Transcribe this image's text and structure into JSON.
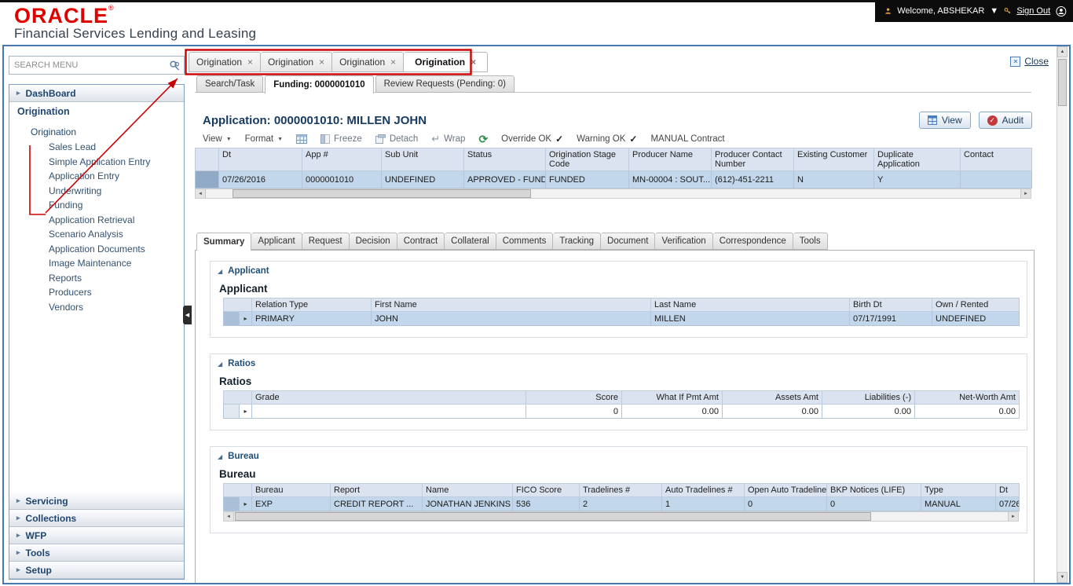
{
  "icons": {
    "caret_down": "▼",
    "chevron_right": "▸",
    "row_expand": "▸",
    "close_box_x": "✕",
    "tab_close": "×",
    "check": "✓",
    "scroll_up": "▲",
    "scroll_down": "▼",
    "scroll_left": "◄",
    "scroll_right": "►",
    "section_disclosure": "◢",
    "collapse_handle": "◀",
    "wrap_arrow": "↵",
    "refresh": "⟳"
  },
  "header": {
    "logo": "ORACLE",
    "logo_mark": "®",
    "subtitle": "Financial Services Lending and Leasing",
    "welcome_label": "Welcome, ABSHEKAR",
    "sign_out_label": "Sign Out"
  },
  "sidebar": {
    "search_placeholder": "SEARCH MENU",
    "dashboard_label": "DashBoard",
    "origination_section_label": "Origination",
    "tree_root": "Origination",
    "tree_items": [
      "Sales Lead",
      "Simple Application Entry",
      "Application Entry",
      "Underwriting",
      "Funding",
      "Application Retrieval",
      "Scenario Analysis",
      "Application Documents",
      "Image Maintenance",
      "Reports",
      "Producers",
      "Vendors"
    ],
    "bottom_items": [
      "Servicing",
      "Collections",
      "WFP",
      "Tools",
      "Setup"
    ]
  },
  "window_tabs": [
    "Origination",
    "Origination",
    "Origination",
    "Origination"
  ],
  "close_label": "Close",
  "page_tabs": [
    "Search/Task",
    "Funding: 0000001010",
    "Review Requests (Pending: 0)"
  ],
  "application": {
    "title": "Application: 0000001010: MILLEN JOHN",
    "view_button": "View",
    "audit_button": "Audit"
  },
  "toolbar": {
    "view": "View",
    "format": "Format",
    "freeze": "Freeze",
    "detach": "Detach",
    "wrap": "Wrap",
    "override_ok": "Override OK",
    "warning_ok": "Warning OK",
    "manual_contract": "MANUAL Contract"
  },
  "main_table": {
    "columns": [
      "Dt",
      "App #",
      "Sub Unit",
      "Status",
      "Origination Stage Code",
      "Producer Name",
      "Producer Contact Number",
      "Existing Customer",
      "Duplicate Application",
      "Contact"
    ],
    "row": [
      "07/26/2016",
      "0000001010",
      "UNDEFINED",
      "APPROVED - FUND...",
      "FUNDED",
      "MN-00004 : SOUT...",
      "(612)-451-2211",
      "N",
      "Y",
      ""
    ]
  },
  "section_tabs": [
    "Summary",
    "Applicant",
    "Request",
    "Decision",
    "Contract",
    "Collateral",
    "Comments",
    "Tracking",
    "Document",
    "Verification",
    "Correspondence",
    "Tools"
  ],
  "sections": {
    "applicant": {
      "header": "Applicant",
      "title": "Applicant",
      "columns": [
        "Relation Type",
        "First Name",
        "Last Name",
        "Birth Dt",
        "Own / Rented"
      ],
      "row": [
        "PRIMARY",
        "JOHN",
        "MILLEN",
        "07/17/1991",
        "UNDEFINED"
      ]
    },
    "ratios": {
      "header": "Ratios",
      "title": "Ratios",
      "columns": [
        "Grade",
        "Score",
        "What If Pmt Amt",
        "Assets Amt",
        "Liabilities (-)",
        "Net-Worth Amt"
      ],
      "row": [
        "",
        "0",
        "0.00",
        "0.00",
        "0.00",
        "0.00"
      ]
    },
    "bureau": {
      "header": "Bureau",
      "title": "Bureau",
      "columns": [
        "Bureau",
        "Report",
        "Name",
        "FICO Score",
        "Tradelines #",
        "Auto Tradelines #",
        "Open Auto Tradelines #",
        "BKP Notices (LIFE)",
        "Type",
        "Dt"
      ],
      "row": [
        "EXP",
        "CREDIT REPORT ...",
        "JONATHAN JENKINS",
        "536",
        "2",
        "1",
        "0",
        "0",
        "MANUAL",
        "07/26"
      ]
    }
  }
}
